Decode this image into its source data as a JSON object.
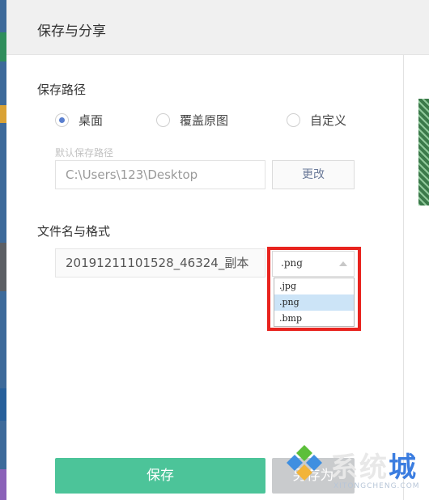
{
  "dialog": {
    "title": "保存与分享",
    "save_path_section": "保存路径",
    "radio_options": [
      {
        "label": "桌面",
        "checked": true
      },
      {
        "label": "覆盖原图",
        "checked": false
      },
      {
        "label": "自定义",
        "checked": false
      }
    ],
    "default_path_hint": "默认保存路径",
    "path_value": "C:\\Users\\123\\Desktop",
    "change_label": "更改",
    "filename_section": "文件名与格式",
    "filename_value": "20191211101528_46324_副本",
    "format": {
      "selected": ".png",
      "options": [
        ".jpg",
        ".png",
        ".bmp"
      ]
    },
    "save_label": "保存",
    "save_as_label": "另存为"
  },
  "watermark": {
    "text_main": "系统",
    "text_accent": "城",
    "subtext": "XITONGCHENG.COM"
  },
  "colors": {
    "accent_green": "#4cc499",
    "radio_blue": "#5a7fcf",
    "highlight_red": "#e8231e",
    "option_selected": "#cce4f7"
  }
}
